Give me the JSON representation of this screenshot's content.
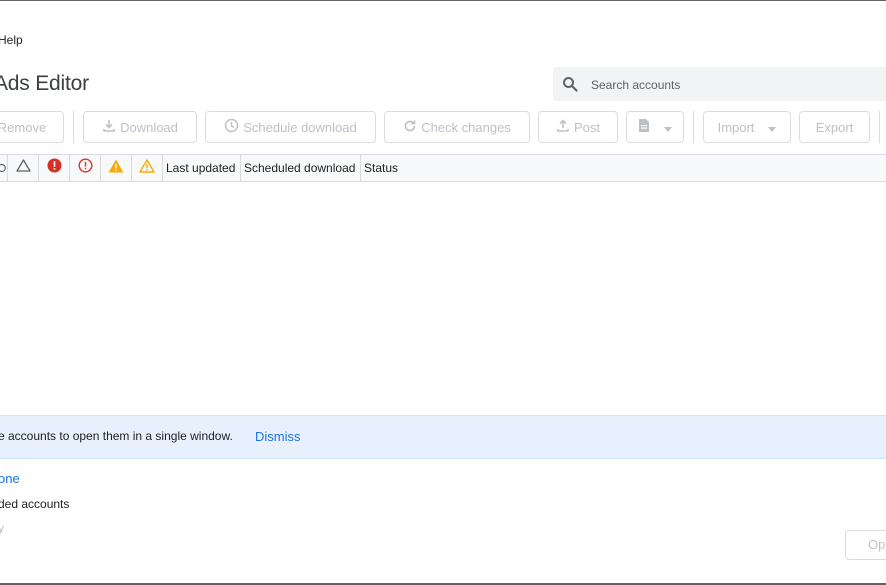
{
  "menu": {
    "help_label": "Help"
  },
  "app": {
    "title": "Ads Editor"
  },
  "search": {
    "placeholder": "Search accounts"
  },
  "toolbar": {
    "remove_label": "Remove",
    "download_label": "Download",
    "schedule_download_label": "Schedule download",
    "check_changes_label": "Check changes",
    "post_label": "Post",
    "import_label": "Import",
    "export_label": "Export"
  },
  "grid": {
    "columns": [
      "Last updated",
      "Scheduled download",
      "Status"
    ],
    "icons": [
      "warning-outline-icon",
      "error-filled-icon",
      "error-outline-icon",
      "warning-filled-icon",
      "warning-outline-yellow-icon"
    ]
  },
  "banner": {
    "text": "e accounts to open them in a single window.",
    "dismiss_label": "Dismiss"
  },
  "footer": {
    "select_none_label": "one",
    "downloaded_accounts_text": "ded accounts",
    "faint_text": "y",
    "open_label": "Op"
  },
  "colors": {
    "accent_blue": "#1a73e8",
    "banner_bg": "#e8f0fe",
    "error_red": "#d93025",
    "warning_yellow": "#f9ab00",
    "disabled_text": "#bdc1c6"
  }
}
